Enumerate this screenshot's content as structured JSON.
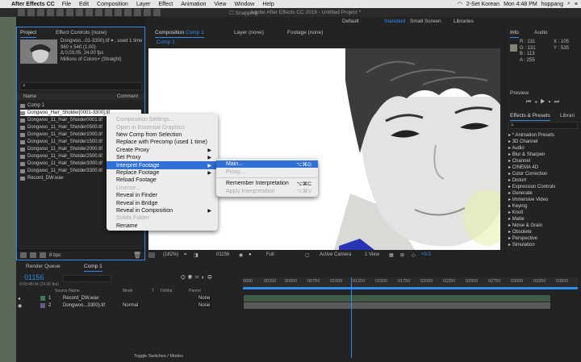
{
  "menubar": {
    "app": "After Effects CC",
    "items": [
      "File",
      "Edit",
      "Composition",
      "Layer",
      "Effect",
      "Animation",
      "View",
      "Window",
      "Help"
    ],
    "input": "2-Set Korean",
    "clock": "Mon 4:48 PM",
    "user": "hoppang"
  },
  "appbar": {
    "title": "Adobe After Effects CC 2018 - Untitled Project *",
    "snapping": "Snapping",
    "workspaces": [
      "Default",
      "Standard",
      "Small Screen",
      "Libraries"
    ]
  },
  "project": {
    "tab": "Project",
    "tab2": "Effect Controls (none)",
    "asset_name": "Dongwoo...01-3300).tif",
    "asset_used": "used 1 time",
    "asset_dims": "960 x 540 (1.00)",
    "asset_dur": "Δ 0;03;05, 24.00 fps",
    "asset_color": "Millions of Colors+ (Straight)",
    "col_name": "Name",
    "col_comment": "Comment",
    "items": [
      "Comp 1",
      "Dongwoo_Hair_Sholder[0001-3300].tif",
      "Dongwoo_11_Hair_Sholder0001.tif",
      "Dongwoo_11_Hair_Sholder0500.tif",
      "Dongwoo_11_Hair_Sholder1000.tif",
      "Dongwoo_11_Hair_Sholder1500.tif",
      "Dongwoo_11_Hair_Sholder2000.tif",
      "Dongwoo_11_Hair_Sholder2500.tif",
      "Dongwoo_11_Hair_Sholder3000.tif",
      "Dongwoo_11_Hair_Sholder3300.tif",
      "Record_DW.wav"
    ],
    "bpc": "8 bpc"
  },
  "viewer": {
    "tab": "Composition",
    "comp": "Comp 1",
    "layer_tab": "Layer (none)",
    "footage_tab": "Footage (none)",
    "subtab": "Comp 1",
    "zoom": "(182%)",
    "timecode": "01156",
    "resolution": "Full",
    "camera": "Active Camera",
    "views": "1 View",
    "exposure": "+0.0"
  },
  "info": {
    "tab": "Info",
    "tab2": "Audio",
    "r": "R : 131",
    "g": "G : 131",
    "b": "B : 113",
    "a": "A : 255",
    "x": "X : 105",
    "y": "Y : 535"
  },
  "preview": {
    "tab": "Preview"
  },
  "effects": {
    "tab": "Effects & Presets",
    "tab2": "Librari",
    "items": [
      "* Animation Presets",
      "3D Channel",
      "Audio",
      "Blur & Sharpen",
      "Channel",
      "CINEMA 4D",
      "Color Correction",
      "Distort",
      "Expression Controls",
      "Generate",
      "Immersive Video",
      "Keying",
      "Knoll",
      "Matte",
      "Noise & Grain",
      "Obsolete",
      "Perspective",
      "Simulation"
    ]
  },
  "context_menu": {
    "items": [
      {
        "label": "Composition Settings...",
        "state": "disabled"
      },
      {
        "label": "Open in Essential Graphics",
        "state": "disabled"
      },
      {
        "label": "New Comp from Selection",
        "state": "enabled"
      },
      {
        "label": "Replace with Precomp (used 1 time)",
        "state": "enabled"
      },
      {
        "label": "Create Proxy",
        "state": "enabled",
        "submenu": true
      },
      {
        "label": "Set Proxy",
        "state": "enabled",
        "submenu": true
      },
      {
        "label": "Interpret Footage",
        "state": "highlight",
        "submenu": true
      },
      {
        "label": "Replace Footage",
        "state": "enabled",
        "submenu": true
      },
      {
        "label": "Reload Footage",
        "state": "enabled"
      },
      {
        "label": "License...",
        "state": "disabled"
      },
      {
        "label": "Reveal in Finder",
        "state": "enabled"
      },
      {
        "label": "Reveal in Bridge",
        "state": "enabled"
      },
      {
        "label": "Reveal in Composition",
        "state": "enabled",
        "submenu": true
      },
      {
        "label": "Solids Folder",
        "state": "disabled"
      },
      {
        "label": "Rename",
        "state": "enabled"
      }
    ]
  },
  "submenu": {
    "items": [
      {
        "label": "Main...",
        "shortcut": "⌥⌘G",
        "state": "highlight"
      },
      {
        "label": "Proxy...",
        "shortcut": "",
        "state": "disabled"
      },
      {
        "label": "Remember Interpretation",
        "shortcut": "⌥⌘C",
        "state": "enabled"
      },
      {
        "label": "Apply Interpretation",
        "shortcut": "⌥⌘V",
        "state": "disabled"
      }
    ]
  },
  "timeline": {
    "tab": "Render Queue",
    "comp_tab": "Comp 1",
    "timecode": "01156",
    "fps": "0:00:48:04 (24.00 fps)",
    "cols": [
      "Source Name",
      "Mode",
      "T",
      "TrkMat",
      "Parent"
    ],
    "layers": [
      {
        "num": "1",
        "name": "Record_DW.wav",
        "mode": "",
        "parent": "None"
      },
      {
        "num": "2",
        "name": "Dongwoo...3300).tif",
        "mode": "Normal",
        "parent": "None"
      }
    ],
    "ticks": [
      "0000",
      "00250",
      "00500",
      "00750",
      "01000",
      "01250",
      "01500",
      "01750",
      "02000",
      "02250",
      "02500",
      "02750",
      "03000",
      "03250",
      "03500"
    ],
    "toggle": "Toggle Switches / Modes"
  }
}
